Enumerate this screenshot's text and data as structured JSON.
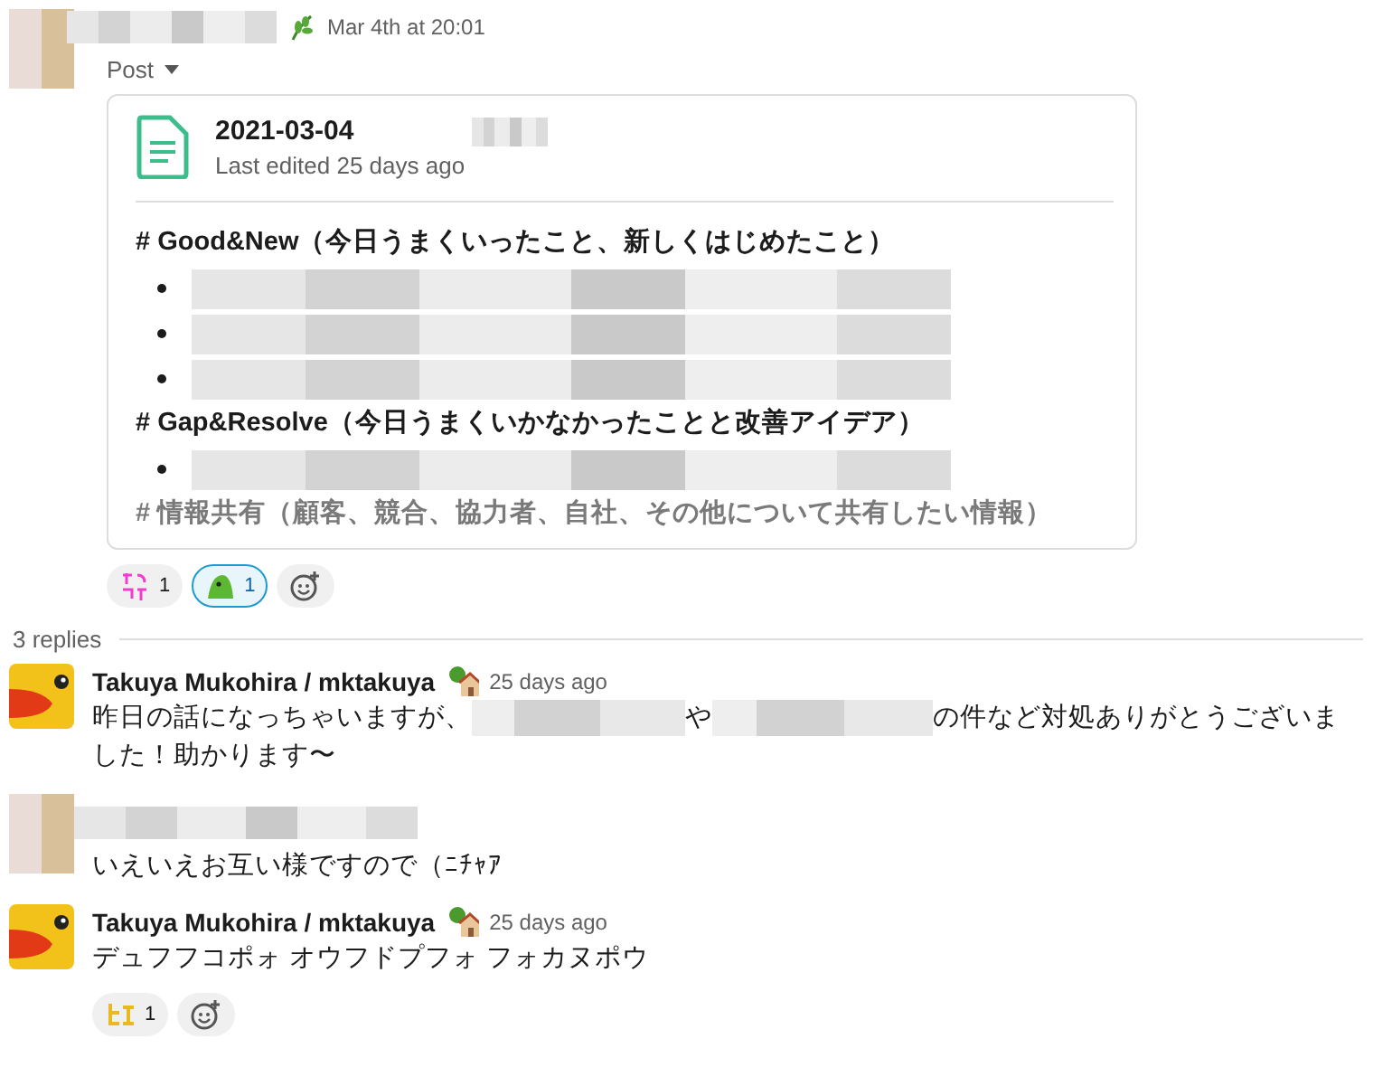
{
  "parent": {
    "time": "Mar 4th at 20:01",
    "post_menu": "Post",
    "post": {
      "title": "2021-03-04",
      "subtitle": "Last edited 25 days ago",
      "sections": [
        {
          "heading": "# Good&New（今日うまくいったこと、新しくはじめたこと）",
          "faded": false,
          "bullets": [
            {
              "kind": "redacted"
            },
            {
              "kind": "redacted"
            },
            {
              "kind": "redacted"
            }
          ]
        },
        {
          "heading": "# Gap&Resolve（今日うまくいかなかったことと改善アイデア）",
          "faded": false,
          "bullets": [
            {
              "kind": "redacted"
            }
          ]
        },
        {
          "heading": "# 情報共有（顧客、競合、協力者、自社、その他について共有したい情報）",
          "faded": true
        }
      ]
    },
    "reactions": [
      {
        "kind": "otsukare",
        "count": "1",
        "selected": false
      },
      {
        "kind": "blob",
        "count": "1",
        "selected": true
      },
      {
        "kind": "add"
      }
    ]
  },
  "replies_label": "3 replies",
  "replies": [
    {
      "kind": "user",
      "name": "Takuya Mukohira / mktakuya",
      "time": "25 days ago",
      "parts": [
        "昨日の話になっちゃいますが、",
        "や",
        "の件など対処ありがとうございました！助かります〜"
      ]
    },
    {
      "kind": "redacted",
      "parts": [
        "いえいえお互い様ですので（ﾆﾁｬｱ"
      ]
    },
    {
      "kind": "user",
      "name": "Takuya Mukohira / mktakuya",
      "time": "25 days ago",
      "parts": [
        "デュフフコポォ オウフドプフォ フォカヌポウ"
      ],
      "reactions": [
        {
          "kind": "hye",
          "count": "1",
          "selected": false
        },
        {
          "kind": "add"
        }
      ]
    }
  ]
}
